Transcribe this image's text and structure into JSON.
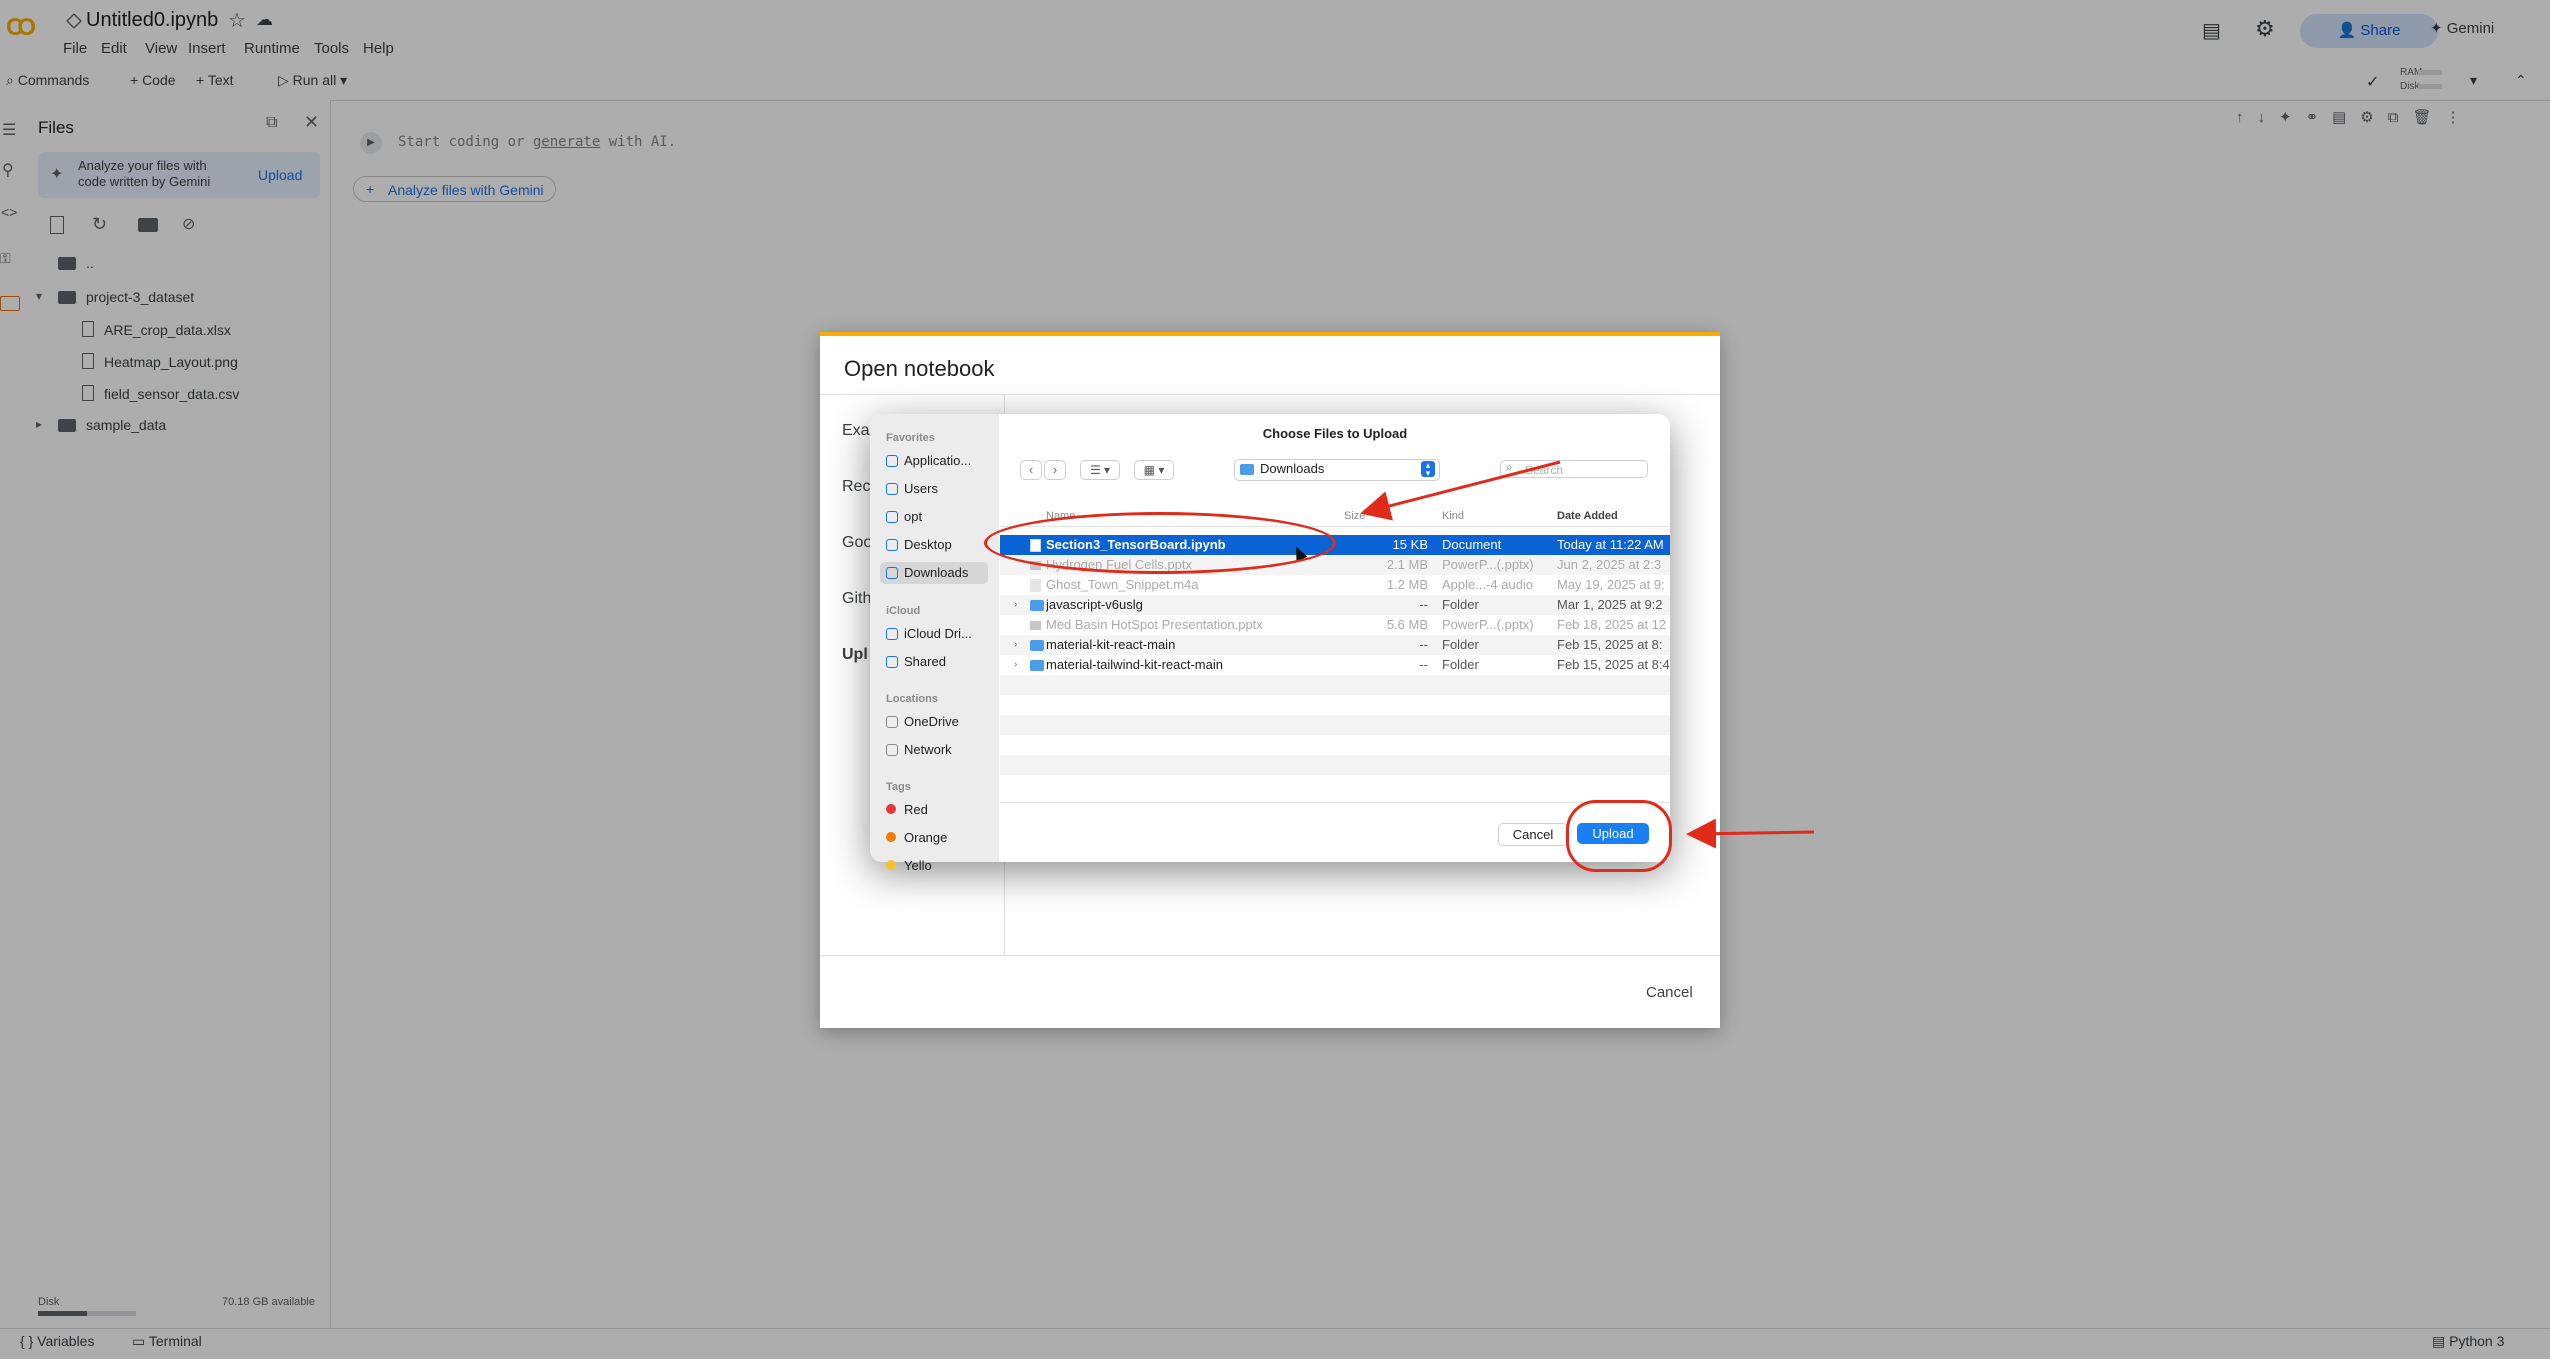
{
  "colab": {
    "logo": "CO",
    "notebook_title": "Untitled0.ipynb",
    "menu": [
      "File",
      "Edit",
      "View",
      "Insert",
      "Runtime",
      "Tools",
      "Help"
    ],
    "toolbar": {
      "commands": "Commands",
      "code": "+ Code",
      "text": "+ Text",
      "run_all": "Run all"
    },
    "share": "Share",
    "gemini": "Gemini",
    "ram_label": "RAM",
    "disk_label": "Disk"
  },
  "sidebar": {
    "title": "Files",
    "gemini_promo": "Analyze your files with code written by Gemini",
    "upload": "Upload",
    "tree": [
      {
        "label": "..",
        "type": "folder-open",
        "indent": 0
      },
      {
        "label": "project-3_dataset",
        "type": "folder",
        "indent": 0
      },
      {
        "label": "ARE_crop_data.xlsx",
        "type": "file",
        "indent": 1
      },
      {
        "label": "Heatmap_Layout.png",
        "type": "file",
        "indent": 1
      },
      {
        "label": "field_sensor_data.csv",
        "type": "file",
        "indent": 1
      },
      {
        "label": "sample_data",
        "type": "folder",
        "indent": 0
      }
    ],
    "disk_label": "Disk",
    "disk_available": "70.18 GB available",
    "disk_fill_fraction": 0.5
  },
  "main": {
    "cell_placeholder_start": "Start coding or ",
    "cell_placeholder_link": "generate",
    "cell_placeholder_end": " with AI.",
    "analyze_button": "Analyze files with Gemini"
  },
  "statusbar": {
    "variables": "Variables",
    "terminal": "Terminal",
    "runtime": "Python 3"
  },
  "open_notebook": {
    "title": "Open notebook",
    "tabs": [
      "Exa",
      "Rec",
      "Goo",
      "Gith",
      "Upl"
    ],
    "cancel": "Cancel"
  },
  "file_picker": {
    "title": "Choose Files to Upload",
    "location": "Downloads",
    "search_placeholder": "Search",
    "favorites_label": "Favorites",
    "favorites": [
      "Applicatio...",
      "Users",
      "opt",
      "Desktop",
      "Downloads"
    ],
    "icloud_label": "iCloud",
    "icloud": [
      "iCloud Dri...",
      "Shared"
    ],
    "locations_label": "Locations",
    "locations": [
      "OneDrive",
      "Network"
    ],
    "tags_label": "Tags",
    "tags": [
      {
        "name": "Red",
        "color": "#e53935"
      },
      {
        "name": "Orange",
        "color": "#f57c00"
      },
      {
        "name": "Yello",
        "color": "#fbc02d"
      }
    ],
    "columns": {
      "name": "Name",
      "size": "Size",
      "kind": "Kind",
      "date": "Date Added"
    },
    "rows": [
      {
        "name": "Section3_TensorBoard.ipynb",
        "size": "15 KB",
        "kind": "Document",
        "date": "Today at 11:22 AM",
        "icon": "doc",
        "selected": true,
        "dim": false,
        "folder": false
      },
      {
        "name": "Hydrogen Fuel Cells.pptx",
        "size": "2.1 MB",
        "kind": "PowerP...(.pptx)",
        "date": "Jun 2, 2025 at 2:3",
        "icon": "pptx",
        "selected": false,
        "dim": true,
        "folder": false
      },
      {
        "name": "Ghost_Town_Snippet.m4a",
        "size": "1.2 MB",
        "kind": "Apple...-4 audio",
        "date": "May 19, 2025 at 9:",
        "icon": "audio",
        "selected": false,
        "dim": true,
        "folder": false
      },
      {
        "name": "javascript-v6uslg",
        "size": "--",
        "kind": "Folder",
        "date": "Mar 1, 2025 at 9:2",
        "icon": "folder",
        "selected": false,
        "dim": false,
        "folder": true
      },
      {
        "name": "Med Basin HotSpot Presentation.pptx",
        "size": "5.6 MB",
        "kind": "PowerP...(.pptx)",
        "date": "Feb 18, 2025 at 12",
        "icon": "pptx",
        "selected": false,
        "dim": true,
        "folder": false
      },
      {
        "name": "material-kit-react-main",
        "size": "--",
        "kind": "Folder",
        "date": "Feb 15, 2025 at 8:",
        "icon": "folder",
        "selected": false,
        "dim": false,
        "folder": true
      },
      {
        "name": "material-tailwind-kit-react-main",
        "size": "--",
        "kind": "Folder",
        "date": "Feb 15, 2025 at 8:4",
        "icon": "folder",
        "selected": false,
        "dim": false,
        "folder": true
      }
    ],
    "cancel": "Cancel",
    "upload": "Upload"
  },
  "colors": {
    "accent": "#1a73e8",
    "annotation": "#e02a1a",
    "selection": "#0a63d4"
  }
}
